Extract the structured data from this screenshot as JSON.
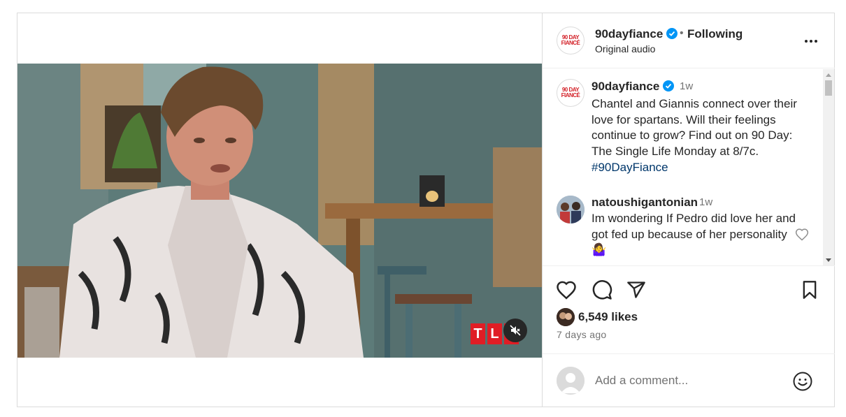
{
  "video": {
    "channel_logo_letters": [
      "T",
      "L",
      "C"
    ],
    "muted": true
  },
  "header": {
    "username": "90dayfiance",
    "logo_text": "90 DAY FIANCÉ",
    "separator": "•",
    "follow_label": "Following",
    "audio_label": "Original audio"
  },
  "caption": {
    "username": "90dayfiance",
    "time": "1w",
    "text": "Chantel and Giannis connect over their love for spartans. Will their feelings continue to grow? Find out on 90 Day: The Single Life Monday at 8/7c.",
    "hashtag": "#90DayFiance"
  },
  "comment": {
    "username": "natoushigantonian",
    "time": "1w",
    "text": "Im wondering If Pedro did love her and got fed up because of her personality",
    "emoji": "🤷‍♀️"
  },
  "likes": {
    "text": "6,549 likes"
  },
  "posted": "7 days ago",
  "add_comment": {
    "placeholder": "Add a comment..."
  },
  "colors": {
    "verified": "#0095f6",
    "hashtag": "#00376b",
    "secondary_text": "#737373",
    "brand_red": "#e01d25"
  }
}
